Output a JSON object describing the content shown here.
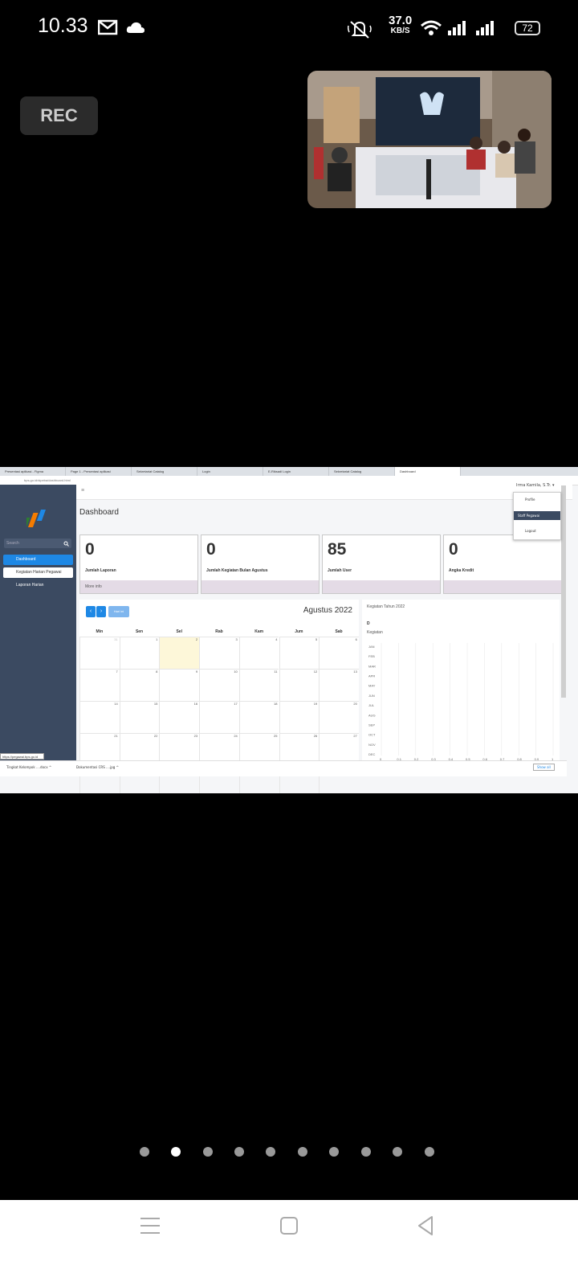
{
  "status_bar": {
    "time": "10.33",
    "net_speed_value": "37.0",
    "net_speed_unit": "KB/S",
    "battery": "72",
    "icons": [
      "gmail-icon",
      "cloud-icon",
      "mute-icon",
      "wifi-icon",
      "signal-icon",
      "signal-icon-2",
      "battery-icon"
    ]
  },
  "rec": {
    "label": "REC"
  },
  "browser": {
    "tabs": [
      "Presentasi aplikasi - Figma",
      "Page 1 - Presentasi aplikasi",
      "Sekretariat Catalog",
      "Login",
      "E-Riksadi Login",
      "Sekretariat Catalog",
      "Dashboard"
    ],
    "address": "bps.go.id/sipeba/dashboard.html",
    "sidebar": {
      "search_placeholder": "Search",
      "items": [
        {
          "label": "Dashboard"
        },
        {
          "label": "Kegiatan Harian Pegawai"
        },
        {
          "label": "Laporan Harian"
        }
      ]
    },
    "user_menu": "Irma Kamila, S.Tr.",
    "dropdown": [
      {
        "label": "Profile"
      },
      {
        "label": "Staff Pegawai"
      },
      {
        "label": "Logout"
      }
    ],
    "page_title": "Dashboard",
    "cards": [
      {
        "value": "0",
        "label": "Jumlah Laporan",
        "footer": "More info"
      },
      {
        "value": "0",
        "label": "Jumlah Kegiatan Bulan Agustus",
        "footer": ""
      },
      {
        "value": "85",
        "label": "Jumlah User",
        "footer": ""
      },
      {
        "value": "0",
        "label": "Angka Kredit",
        "footer": ""
      }
    ],
    "calendar": {
      "title": "Agustus 2022",
      "today_label": "Hari ini",
      "days": [
        "Min",
        "Sen",
        "Sel",
        "Rab",
        "Kam",
        "Jum",
        "Sab"
      ],
      "weeks": [
        [
          "31",
          "1",
          "2",
          "3",
          "4",
          "5",
          "6"
        ],
        [
          "7",
          "8",
          "9",
          "10",
          "11",
          "12",
          "13"
        ],
        [
          "14",
          "15",
          "16",
          "17",
          "18",
          "19",
          "20"
        ],
        [
          "21",
          "22",
          "23",
          "24",
          "25",
          "26",
          "27"
        ],
        [
          "28",
          "29",
          "30",
          "31",
          "1",
          "2",
          "3"
        ]
      ]
    },
    "chart_panel": {
      "title": "Kegiatan Tahun 2022",
      "series_label": "D",
      "legend": "Kegiatan",
      "months": [
        "JAN",
        "FEB",
        "MAR",
        "APR",
        "MAY",
        "JUN",
        "JUL",
        "AUG",
        "SEP",
        "OCT",
        "NOV",
        "DEC"
      ],
      "xticks": [
        "0",
        "0.1",
        "0.2",
        "0.3",
        "0.4",
        "0.5",
        "0.6",
        "0.7",
        "0.8",
        "0.9",
        "1"
      ]
    },
    "downloads": [
      {
        "name": "Tingkat Kelompok ....docx"
      },
      {
        "name": "Dokumentasi CRS ....jpg"
      }
    ],
    "show_all": "Show all",
    "status_url": "https://pegawai.bps.go.id"
  }
}
